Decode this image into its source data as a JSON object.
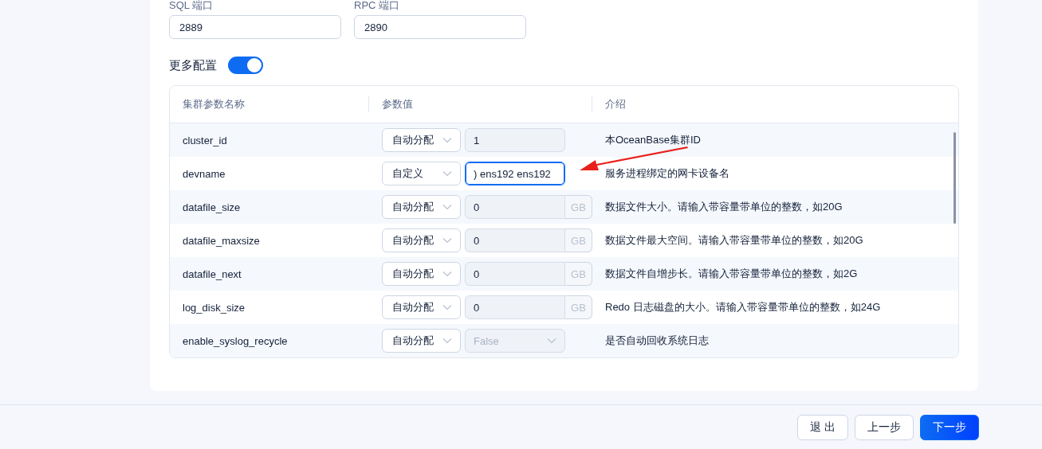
{
  "fields": [
    {
      "label": "SQL 端口",
      "value": "2889"
    },
    {
      "label": "RPC 端口",
      "value": "2890"
    }
  ],
  "more_config": {
    "label": "更多配置",
    "on": true
  },
  "params_table": {
    "columns": [
      "集群参数名称",
      "参数值",
      "介绍"
    ],
    "rows": [
      {
        "name": "cluster_id",
        "mode": "自动分配",
        "kind": "input",
        "value": "1",
        "disabled": true,
        "focused": false,
        "description": "本OceanBase集群ID"
      },
      {
        "name": "devname",
        "mode": "自定义",
        "kind": "input",
        "value": ") ens192 ens192",
        "disabled": false,
        "focused": true,
        "description": "服务进程绑定的网卡设备名"
      },
      {
        "name": "datafile_size",
        "mode": "自动分配",
        "kind": "input",
        "value": "0",
        "unit": "GB",
        "disabled": true,
        "focused": false,
        "description": "数据文件大小。请输入带容量带单位的整数，如20G"
      },
      {
        "name": "datafile_maxsize",
        "mode": "自动分配",
        "kind": "input",
        "value": "0",
        "unit": "GB",
        "disabled": true,
        "focused": false,
        "description": "数据文件最大空间。请输入带容量带单位的整数，如20G"
      },
      {
        "name": "datafile_next",
        "mode": "自动分配",
        "kind": "input",
        "value": "0",
        "unit": "GB",
        "disabled": true,
        "focused": false,
        "description": "数据文件自增步长。请输入带容量带单位的整数，如2G"
      },
      {
        "name": "log_disk_size",
        "mode": "自动分配",
        "kind": "input",
        "value": "0",
        "unit": "GB",
        "disabled": true,
        "focused": false,
        "description": "Redo 日志磁盘的大小。请输入带容量带单位的整数，如24G"
      },
      {
        "name": "enable_syslog_recycle",
        "mode": "自动分配",
        "kind": "select",
        "placeholder": "False",
        "disabled": true,
        "focused": false,
        "description": "是否自动回收系统日志"
      }
    ]
  },
  "footer_buttons": [
    {
      "label": "退 出",
      "primary": false
    },
    {
      "label": "上一步",
      "primary": false
    },
    {
      "label": "下一步",
      "primary": true
    }
  ]
}
